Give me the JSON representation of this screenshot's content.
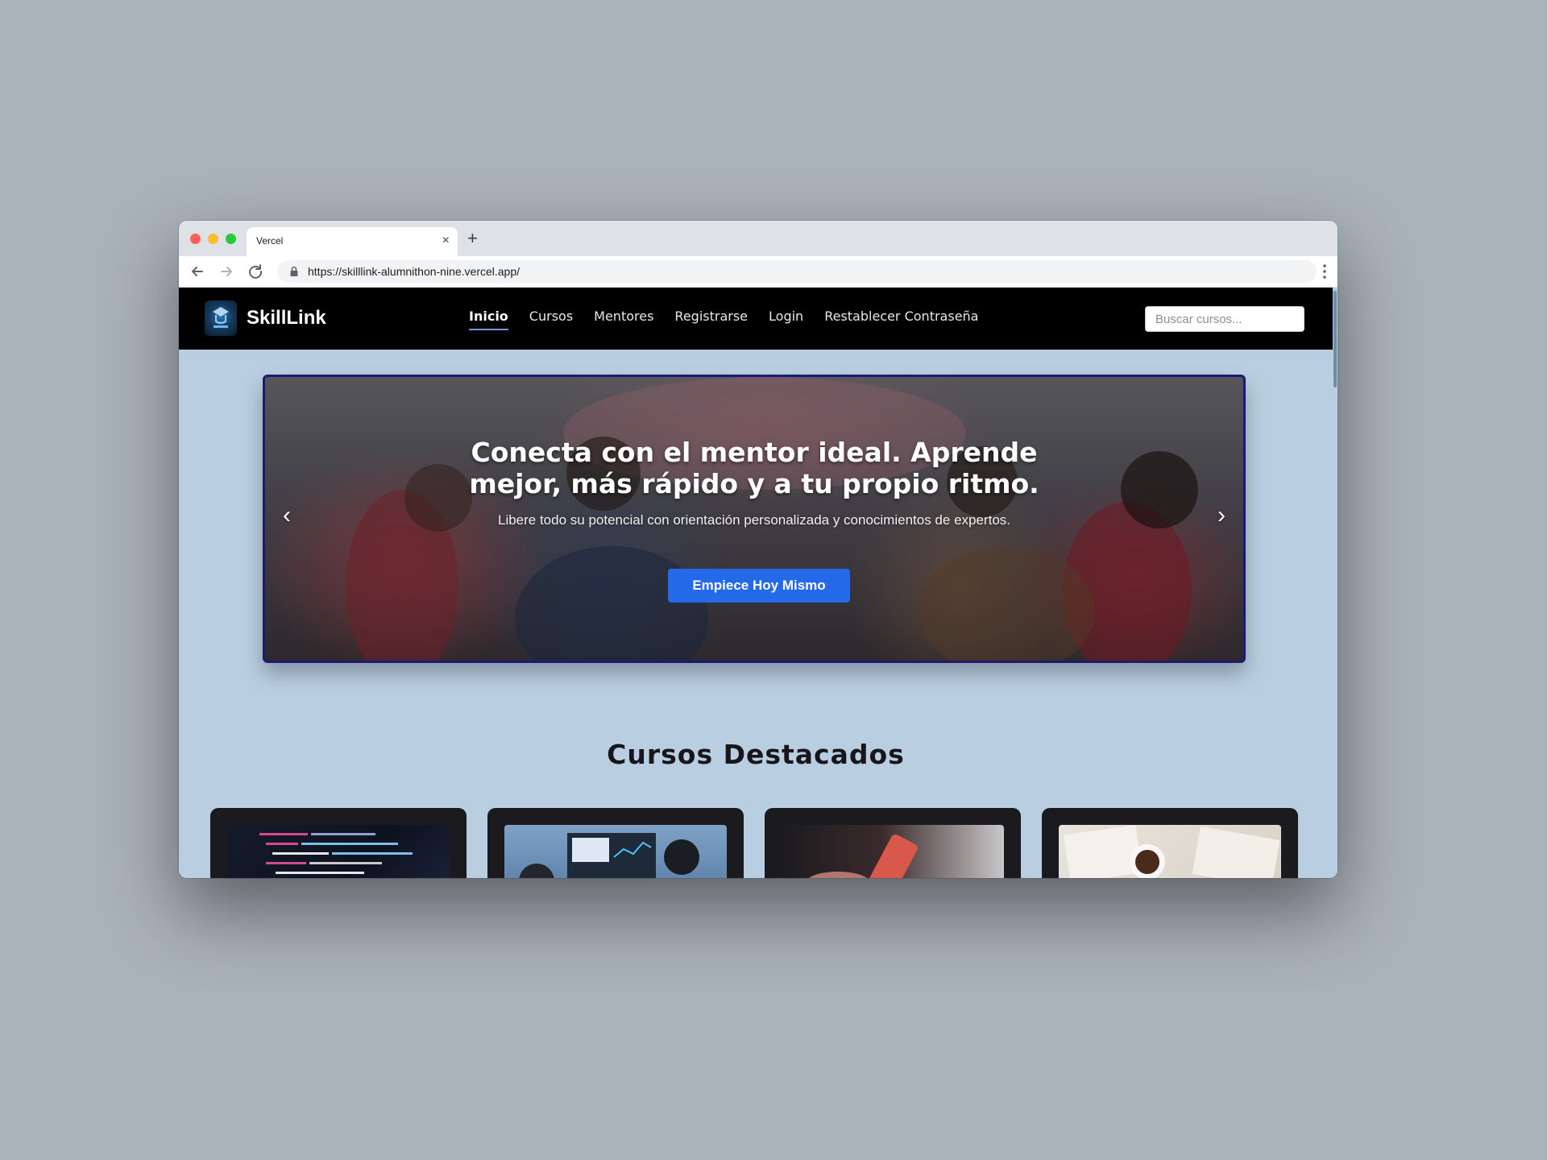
{
  "browser": {
    "tab_title": "Vercel",
    "tab_close": "×",
    "new_tab": "+",
    "url": "https://skilllink-alumnithon-nine.vercel.app/"
  },
  "site": {
    "brand": "SkillLink",
    "nav": [
      {
        "label": "Inicio",
        "active": true
      },
      {
        "label": "Cursos"
      },
      {
        "label": "Mentores"
      },
      {
        "label": "Registrarse"
      },
      {
        "label": "Login"
      },
      {
        "label": "Restablecer Contraseña"
      }
    ],
    "search_placeholder": "Buscar cursos..."
  },
  "hero": {
    "title": "Conecta con el mentor ideal. Aprende mejor, más rápido y a tu propio ritmo.",
    "subtitle": "Libere todo su potencial con orientación personalizada y conocimientos de expertos.",
    "cta": "Empiece Hoy Mismo",
    "prev": "‹",
    "next": "›"
  },
  "featured": {
    "title": "Cursos Destacados"
  },
  "colors": {
    "nav_bg": "#000000",
    "page_bg": "#b9cfe1",
    "cta_blue": "#2469e8",
    "hero_border": "#1d1a75",
    "card_bg": "#1b1a1f"
  }
}
